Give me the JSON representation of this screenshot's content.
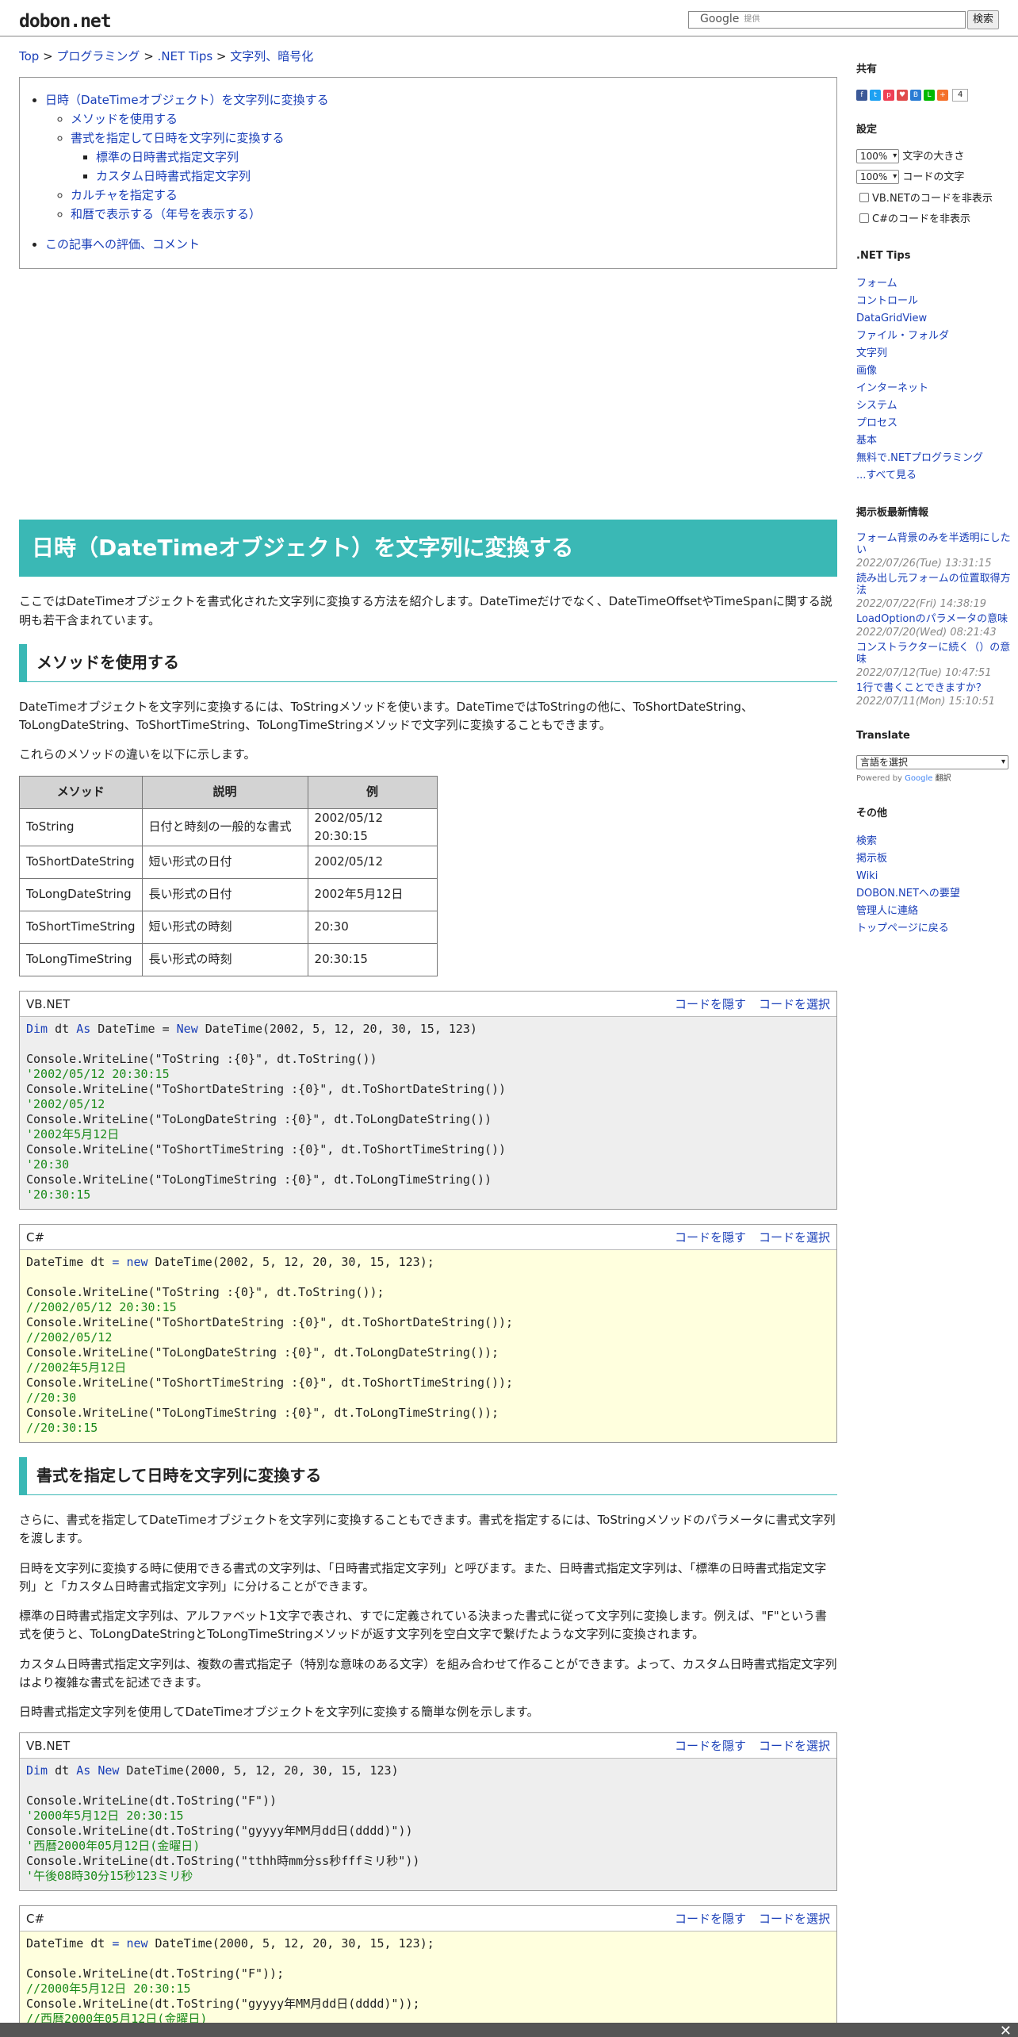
{
  "header": {
    "logo": "dobon.net",
    "search_google": "Google",
    "search_powered": "提供",
    "search_button": "検索"
  },
  "breadcrumb": [
    "Top",
    "プログラミング",
    ".NET Tips",
    "文字列、暗号化"
  ],
  "toc": {
    "l1a": "日時（DateTimeオブジェクト）を文字列に変換する",
    "l2a": "メソッドを使用する",
    "l2b": "書式を指定して日時を文字列に変換する",
    "l3a": "標準の日時書式指定文字列",
    "l3b": "カスタム日時書式指定文字列",
    "l2c": "カルチャを指定する",
    "l2d": "和暦で表示する（年号を表示する）",
    "l1b": "この記事への評価、コメント"
  },
  "article": {
    "title": "日時（DateTimeオブジェクト）を文字列に変換する",
    "intro": "ここではDateTimeオブジェクトを書式化された文字列に変換する方法を紹介します。DateTimeだけでなく、DateTimeOffsetやTimeSpanに関する説明も若干含まれています。",
    "h2_methods": "メソッドを使用する",
    "p_methods1": "DateTimeオブジェクトを文字列に変換するには、ToStringメソッドを使います。DateTimeではToStringの他に、ToShortDateString、ToLongDateString、ToShortTimeString、ToLongTimeStringメソッドで文字列に変換することもできます。",
    "p_methods2": "これらのメソッドの違いを以下に示します。",
    "table": {
      "headers": [
        "メソッド",
        "説明",
        "例"
      ],
      "rows": [
        [
          "ToString",
          "日付と時刻の一般的な書式",
          "2002/05/12 20:30:15"
        ],
        [
          "ToShortDateString",
          "短い形式の日付",
          "2002/05/12"
        ],
        [
          "ToLongDateString",
          "長い形式の日付",
          "2002年5月12日"
        ],
        [
          "ToShortTimeString",
          "短い形式の時刻",
          "20:30"
        ],
        [
          "ToLongTimeString",
          "長い形式の時刻",
          "20:30:15"
        ]
      ]
    },
    "h2_format": "書式を指定して日時を文字列に変換する",
    "p_f1": "さらに、書式を指定してDateTimeオブジェクトを文字列に変換することもできます。書式を指定するには、ToStringメソッドのパラメータに書式文字列を渡します。",
    "p_f2": "日時を文字列に変換する時に使用できる書式の文字列は、「日時書式指定文字列」と呼びます。また、日時書式指定文字列は、「標準の日時書式指定文字列」と「カスタム日時書式指定文字列」に分けることができます。",
    "p_f3": "標準の日時書式指定文字列は、アルファベット1文字で表され、すでに定義されている決まった書式に従って文字列に変換します。例えば、\"F\"という書式を使うと、ToLongDateStringとToLongTimeStringメソッドが返す文字列を空白文字で繋げたような文字列に変換されます。",
    "p_f4": "カスタム日時書式指定文字列は、複数の書式指定子（特別な意味のある文字）を組み合わせて作ることができます。よって、カスタム日時書式指定文字列はより複雑な書式を記述できます。",
    "p_f5": "日時書式指定文字列を使用してDateTimeオブジェクトを文字列に変換する簡単な例を示します。"
  },
  "code": {
    "hide": "コードを隠す",
    "select": "コードを選択",
    "vb": "VB.NET",
    "cs": "C#",
    "b1_l1_kw1": "Dim",
    "b1_l1_a": " dt ",
    "b1_l1_kw2": "As",
    "b1_l1_b": " DateTime = ",
    "b1_l1_kw3": "New",
    "b1_l1_c": " DateTime(2002, 5, 12, 20, 30, 15, 123)",
    "b1_l2": "Console.WriteLine(\"ToString :{0}\", dt.ToString())",
    "b1_c2": "'2002/05/12 20:30:15",
    "b1_l3": "Console.WriteLine(\"ToShortDateString :{0}\", dt.ToShortDateString())",
    "b1_c3": "'2002/05/12",
    "b1_l4": "Console.WriteLine(\"ToLongDateString :{0}\", dt.ToLongDateString())",
    "b1_c4": "'2002年5月12日",
    "b1_l5": "Console.WriteLine(\"ToShortTimeString :{0}\", dt.ToShortTimeString())",
    "b1_c5": "'20:30",
    "b1_l6": "Console.WriteLine(\"ToLongTimeString :{0}\", dt.ToLongTimeString())",
    "b1_c6": "'20:30:15",
    "b2_l1_a": "DateTime dt ",
    "b2_l1_op": "=",
    "b2_l1_sp": " ",
    "b2_l1_kw": "new",
    "b2_l1_c": " DateTime(2002, 5, 12, 20, 30, 15, 123);",
    "b2_l2": "Console.WriteLine(\"ToString :{0}\", dt.ToString());",
    "b2_c2": "//2002/05/12 20:30:15",
    "b2_l3": "Console.WriteLine(\"ToShortDateString :{0}\", dt.ToShortDateString());",
    "b2_c3": "//2002/05/12",
    "b2_l4": "Console.WriteLine(\"ToLongDateString :{0}\", dt.ToLongDateString());",
    "b2_c4": "//2002年5月12日",
    "b2_l5": "Console.WriteLine(\"ToShortTimeString :{0}\", dt.ToShortTimeString());",
    "b2_c5": "//20:30",
    "b2_l6": "Console.WriteLine(\"ToLongTimeString :{0}\", dt.ToLongTimeString());",
    "b2_c6": "//20:30:15",
    "b3_l1_a": " dt ",
    "b3_l1_c": " DateTime(2000, 5, 12, 20, 30, 15, 123)",
    "b3_l2": "Console.WriteLine(dt.ToString(\"F\"))",
    "b3_c2": "'2000年5月12日 20:30:15",
    "b3_l3": "Console.WriteLine(dt.ToString(\"gyyyy年MM月dd日(dddd)\"))",
    "b3_c3": "'西暦2000年05月12日(金曜日)",
    "b3_l4": "Console.WriteLine(dt.ToString(\"tthh時mm分ss秒fffミリ秒\"))",
    "b3_c4": "'午後08時30分15秒123ミリ秒",
    "b4_l1_c": " DateTime(2000, 5, 12, 20, 30, 15, 123);",
    "b4_l2": "Console.WriteLine(dt.ToString(\"F\"));",
    "b4_c2": "//2000年5月12日 20:30:15",
    "b4_l3": "Console.WriteLine(dt.ToString(\"gyyyy年MM月dd日(dddd)\"));",
    "b4_c3": "//西暦2000年05月12日(金曜日)"
  },
  "sidebar": {
    "share_title": "共有",
    "share_count": "4",
    "settings_title": "設定",
    "font_size_val": "100%",
    "font_size_label": "文字の大きさ",
    "code_size_val": "100%",
    "code_size_label": "コードの文字",
    "hide_vb": "VB.NETのコードを非表示",
    "hide_cs": "C#のコードを非表示",
    "tips_title": ".NET Tips",
    "tips": [
      "フォーム",
      "コントロール",
      "DataGridView",
      "ファイル・フォルダ",
      "文字列",
      "画像",
      "インターネット",
      "システム",
      "プロセス",
      "基本",
      "無料で.NETプログラミング",
      "...すべて見る"
    ],
    "bbs_title": "掲示板最新情報",
    "bbs": [
      {
        "t": "フォーム背景のみを半透明にしたい",
        "d": "2022/07/26(Tue) 13:31:15"
      },
      {
        "t": "読み出し元フォームの位置取得方法",
        "d": "2022/07/22(Fri) 14:38:19"
      },
      {
        "t": "LoadOptionのパラメータの意味",
        "d": "2022/07/20(Wed) 08:21:43"
      },
      {
        "t": "コンストラクターに続く（）の意味",
        "d": "2022/07/12(Tue) 10:47:51"
      },
      {
        "t": "1行で書くことできますか？",
        "d": "2022/07/11(Mon) 15:10:51"
      }
    ],
    "translate_title": "Translate",
    "translate_sel": "言語を選択",
    "powered": "Powered by",
    "google": "Google",
    "translate_word": "翻訳",
    "other_title": "その他",
    "other": [
      "検索",
      "掲示板",
      "Wiki",
      "DOBON.NETへの要望",
      "管理人に連絡",
      "トップページに戻る"
    ]
  },
  "colors": {
    "accent": "#3ab8b5",
    "link": "#1a3fb8",
    "comment": "#1a8a1a"
  }
}
